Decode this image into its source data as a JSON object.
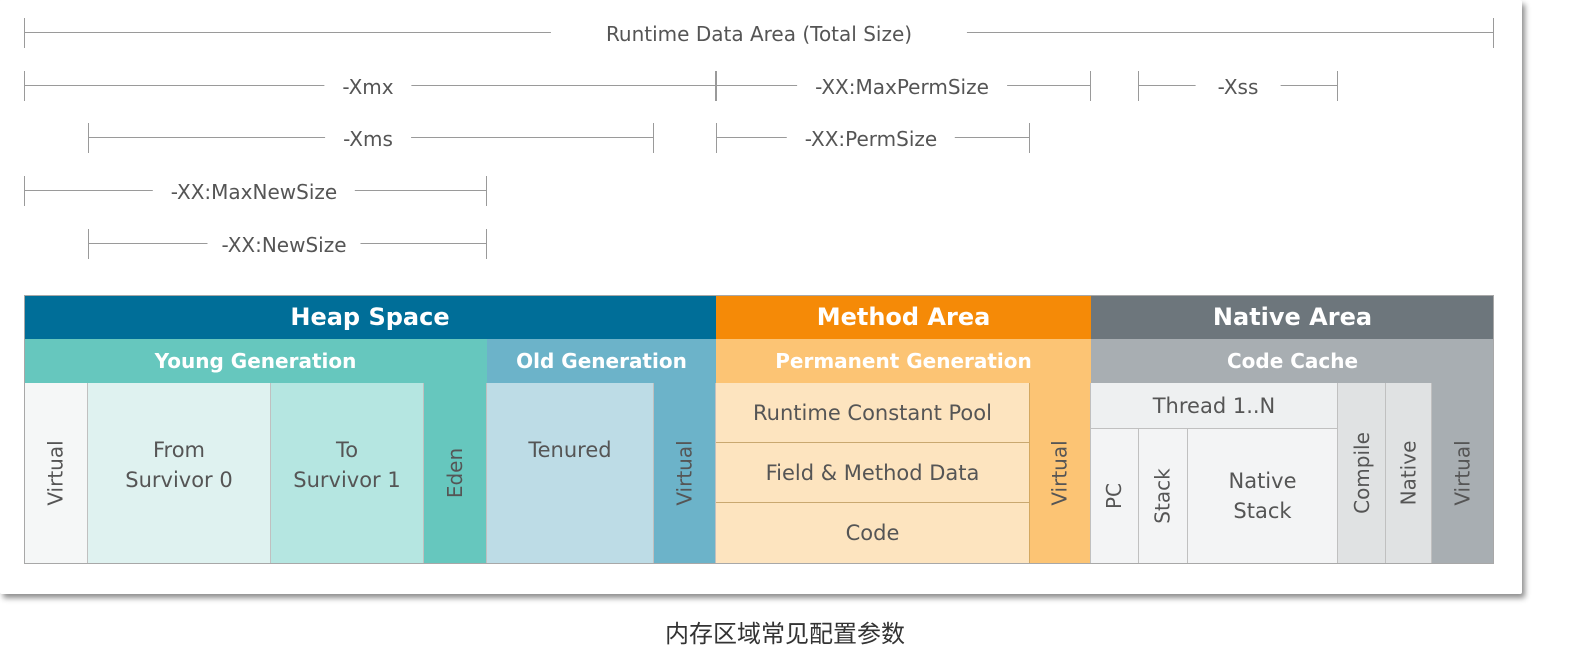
{
  "dimensions": {
    "runtime_total": "Runtime Data Area (Total Size)",
    "xmx": "-Xmx",
    "max_perm_size": "-XX:MaxPermSize",
    "xss": "-Xss",
    "xms": "-Xms",
    "perm_size": "-XX:PermSize",
    "max_new_size": "-XX:MaxNewSize",
    "new_size": "-XX:NewSize"
  },
  "heap": {
    "title": "Heap Space",
    "young_generation": "Young Generation",
    "old_generation": "Old Generation",
    "virtual_left": "Virtual",
    "from_survivor": "From\nSurvivor 0",
    "to_survivor": "To\nSurvivor 1",
    "eden": "Eden",
    "tenured": "Tenured",
    "virtual_old": "Virtual"
  },
  "method": {
    "title": "Method Area",
    "permanent_generation": "Permanent Generation",
    "runtime_constant_pool": "Runtime Constant Pool",
    "field_method_data": "Field & Method Data",
    "code": "Code",
    "virtual": "Virtual"
  },
  "native": {
    "title": "Native Area",
    "code_cache": "Code Cache",
    "thread": "Thread 1..N",
    "pc": "PC",
    "stack": "Stack",
    "native_stack": "Native\nStack",
    "compile": "Compile",
    "native": "Native",
    "virtual": "Virtual"
  },
  "colors": {
    "heap_header": "#006e98",
    "young_header": "#66c7be",
    "old_header": "#6cb3c9",
    "method_header": "#f58a07",
    "perm_header": "#fcc474",
    "native_header": "#6d767c",
    "codecache_header": "#a8aeb2"
  },
  "caption": "内存区域常见配置参数"
}
